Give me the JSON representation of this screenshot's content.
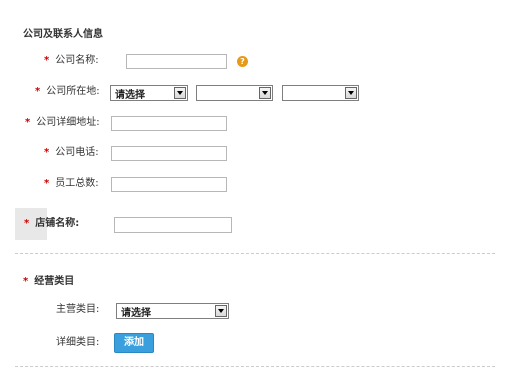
{
  "section_title": "公司及联系人信息",
  "required_mark": "*",
  "help_icon_glyph": "?",
  "fields": {
    "company_name": {
      "label": "公司名称:",
      "value": ""
    },
    "company_location": {
      "label": "公司所在地:",
      "province": "请选择",
      "city": "",
      "district": ""
    },
    "company_address": {
      "label": "公司详细地址:",
      "value": ""
    },
    "company_phone": {
      "label": "公司电话:",
      "value": ""
    },
    "employee_count": {
      "label": "员工总数:",
      "value": ""
    },
    "store_name": {
      "label": "店铺名称:",
      "value": ""
    }
  },
  "business": {
    "title": "经营类目",
    "main_category": {
      "label": "主营类目:",
      "value": "请选择"
    },
    "detail_category": {
      "label": "详细类目:",
      "button": "添加"
    }
  },
  "colors": {
    "required_star": "#cc0000",
    "help_icon": "#e59a1a",
    "add_button": "#3aa0dd"
  }
}
